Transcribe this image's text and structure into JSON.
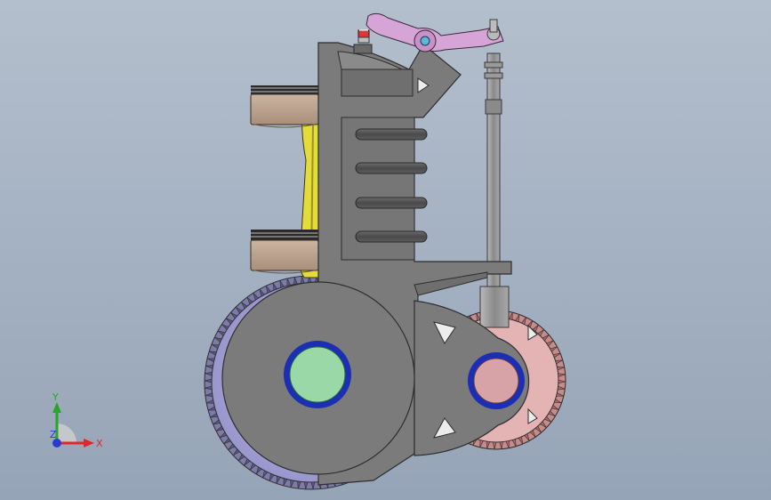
{
  "triad": {
    "x_label": "X",
    "y_label": "Y",
    "z_label": "Z"
  },
  "colors": {
    "background_top": "#b4bfcd",
    "background_bottom": "#96a4b7",
    "block": "#7b7b7b",
    "block_edge": "#2e2e2e",
    "piston": "#bba28e",
    "connecting_rod": "#e4dc3a",
    "rocker_arm": "#d6a4d6",
    "injector_red": "#d23b3b",
    "large_gear": "#a8a6d8",
    "large_hub": "#9ad8a8",
    "small_gear": "#e0a3a3",
    "small_hub": "#d8a3a6",
    "hub_ring": "#1c2fb4",
    "fins": "#5a5a5a",
    "axis_x": "#e0262a",
    "axis_y": "#2aa52a",
    "axis_z": "#2a3ad0"
  }
}
